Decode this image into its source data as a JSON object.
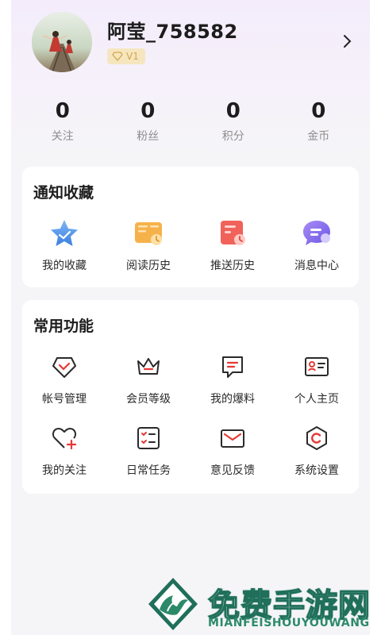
{
  "profile": {
    "username": "阿莹_758582",
    "level": "V1"
  },
  "stats": [
    {
      "value": "0",
      "label": "关注"
    },
    {
      "value": "0",
      "label": "粉丝"
    },
    {
      "value": "0",
      "label": "积分"
    },
    {
      "value": "0",
      "label": "金币"
    }
  ],
  "notify_section": {
    "title": "通知收藏",
    "items": [
      {
        "label": "我的收藏",
        "icon": "star-icon"
      },
      {
        "label": "阅读历史",
        "icon": "book-history-icon"
      },
      {
        "label": "推送历史",
        "icon": "push-history-icon"
      },
      {
        "label": "消息中心",
        "icon": "message-center-icon"
      }
    ]
  },
  "common_section": {
    "title": "常用功能",
    "row1": [
      {
        "label": "帐号管理",
        "icon": "account-icon"
      },
      {
        "label": "会员等级",
        "icon": "crown-icon"
      },
      {
        "label": "我的爆料",
        "icon": "chat-icon"
      },
      {
        "label": "个人主页",
        "icon": "id-card-icon"
      }
    ],
    "row2": [
      {
        "label": "我的关注",
        "icon": "heart-plus-icon"
      },
      {
        "label": "日常任务",
        "icon": "task-list-icon"
      },
      {
        "label": "意见反馈",
        "icon": "mail-icon"
      },
      {
        "label": "系统设置",
        "icon": "settings-icon"
      }
    ]
  },
  "watermark": {
    "title": "免费手游网",
    "subtitle": "MIANFEISHOUYOUWANG"
  },
  "colors": {
    "accent": "#e53935",
    "badge": "#d3a64a"
  }
}
